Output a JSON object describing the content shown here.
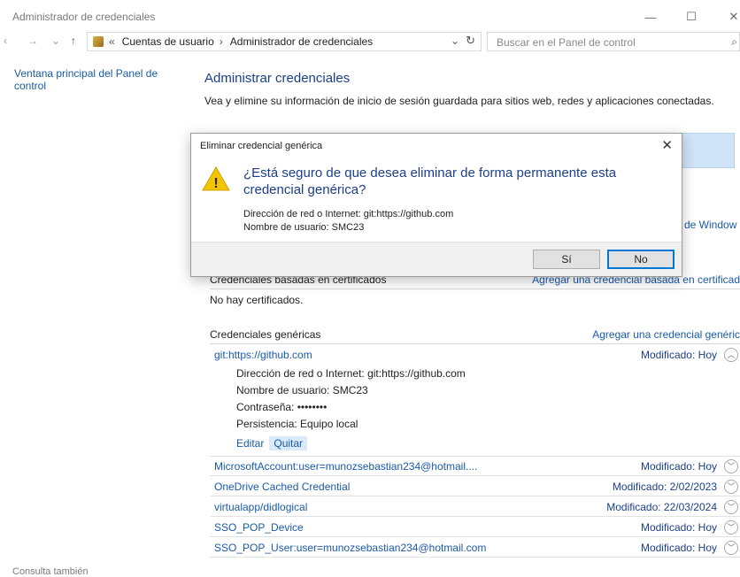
{
  "window": {
    "title": "Administrador de credenciales",
    "minimize_glyph": "—",
    "maximize_glyph": "☐",
    "close_glyph": "✕"
  },
  "nav": {
    "back_glyph": "‹",
    "forward_glyph": "→",
    "recent_glyph": "⌄",
    "up_glyph": "↑",
    "breadcrumb_prefix": "«",
    "breadcrumb": [
      "Cuentas de usuario",
      "Administrador de credenciales"
    ],
    "separator": "›",
    "dropdown_glyph": "⌄",
    "refresh_glyph": "↻",
    "search_placeholder": "Buscar en el Panel de control",
    "search_glyph": "⌕"
  },
  "sidebar": {
    "home_link": "Ventana principal del Panel de control",
    "see_also": "Consulta también"
  },
  "main": {
    "title": "Administrar credenciales",
    "description": "Vea y elimine su información de inicio de sesión guardada para sitios web, redes y aplicaciones conectadas.",
    "windows_link_partial": "de Window"
  },
  "certificates": {
    "header": "Credenciales basadas en certificados",
    "add_link": "Agregar una credencial basada en certificad",
    "empty": "No hay certificados."
  },
  "generic": {
    "header": "Credenciales genéricas",
    "add_link": "Agregar una credencial genéric",
    "expanded": {
      "name": "git:https://github.com",
      "modified": "Modificado:  Hoy",
      "chevron": "︿",
      "address": "Dirección de red o Internet:  git:https://github.com",
      "username": "Nombre de usuario:  SMC23",
      "password": "Contraseña:  ••••••••",
      "persistence": "Persistencia:  Equipo local",
      "edit": "Editar",
      "remove": "Quitar"
    },
    "rows": [
      {
        "name": "MicrosoftAccount:user=munozsebastian234@hotmail....",
        "modified": "Modificado:  Hoy",
        "chevron": "﹀"
      },
      {
        "name": "OneDrive Cached Credential",
        "modified": "Modificado:  2/02/2023",
        "chevron": "﹀"
      },
      {
        "name": "virtualapp/didlogical",
        "modified": "Modificado:  22/03/2024",
        "chevron": "﹀"
      },
      {
        "name": "SSO_POP_Device",
        "modified": "Modificado:  Hoy",
        "chevron": "﹀"
      },
      {
        "name": "SSO_POP_User:user=munozsebastian234@hotmail.com",
        "modified": "Modificado:  Hoy",
        "chevron": "﹀"
      }
    ]
  },
  "dialog": {
    "title": "Eliminar credencial genérica",
    "close_glyph": "✕",
    "warning_glyph": "!",
    "question": "¿Está seguro de que desea eliminar de forma permanente esta credencial genérica?",
    "address": "Dirección de red o Internet: git:https://github.com",
    "username": "Nombre de usuario: SMC23",
    "yes": "Sí",
    "no": "No"
  },
  "colors": {
    "link": "#1a5aa8",
    "heading": "#1a3f8a",
    "warning": "#f2c500",
    "focus": "#0078d7"
  }
}
